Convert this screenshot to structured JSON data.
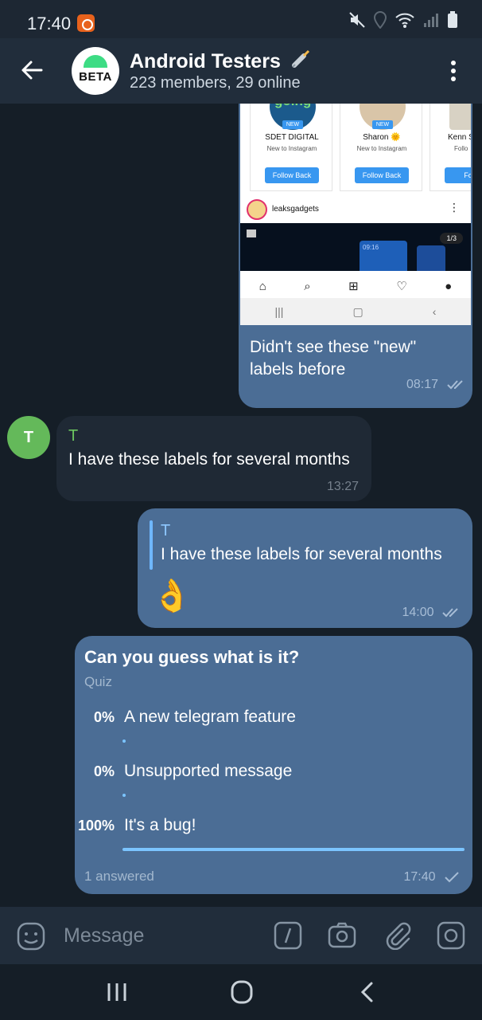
{
  "status_bar": {
    "time": "17:40"
  },
  "header": {
    "avatar_text": "BETA",
    "title": "Android Testers",
    "subtitle": "223 members, 29 online",
    "icons": [
      "back-arrow-icon",
      "menu-dots-icon"
    ]
  },
  "screenshot_message": {
    "suggestions": [
      {
        "new_label": "NEW",
        "name": "SDET DIGITAL",
        "sub": "New to Instagram",
        "button": "Follow Back",
        "pic_color": "#1b5a8c",
        "pic_text": "going"
      },
      {
        "new_label": "NEW",
        "name": "Sharon 🌞",
        "sub": "New to Instagram",
        "button": "Follow Back",
        "pic_color": "#d9c5a8",
        "pic_text": ""
      },
      {
        "new_label": "",
        "name": "Kenn S",
        "sub": "Follo",
        "button": "Follo",
        "pic_color": "#d8d2c4",
        "pic_text": ""
      }
    ],
    "post_account": "leaksgadgets",
    "post_counter": "1/3",
    "post_phone_time": "09:16",
    "caption": "Didn't see these \"new\" labels before",
    "time": "08:17"
  },
  "incoming_message": {
    "avatar_letter": "T",
    "sender": "T",
    "text": "I have these labels for several months",
    "time": "13:27"
  },
  "reply_message": {
    "quote_name": "T",
    "quote_text": "I have these labels for several months",
    "emoji": "👌",
    "time": "14:00"
  },
  "quiz": {
    "question": "Can you guess what is it?",
    "type_label": "Quiz",
    "options": [
      {
        "percent": "0%",
        "text": "A new telegram feature",
        "fraction": 0
      },
      {
        "percent": "0%",
        "text": "Unsupported message",
        "fraction": 0
      },
      {
        "percent": "100%",
        "text": "It's a bug!",
        "fraction": 1.0
      }
    ],
    "answered": "1 answered",
    "time": "17:40"
  },
  "input": {
    "placeholder": "Message"
  },
  "colors": {
    "outgoing": "#4b6d95",
    "incoming": "#1f2935",
    "accent": "#7bc4ff",
    "sender_green": "#6bc45f"
  }
}
